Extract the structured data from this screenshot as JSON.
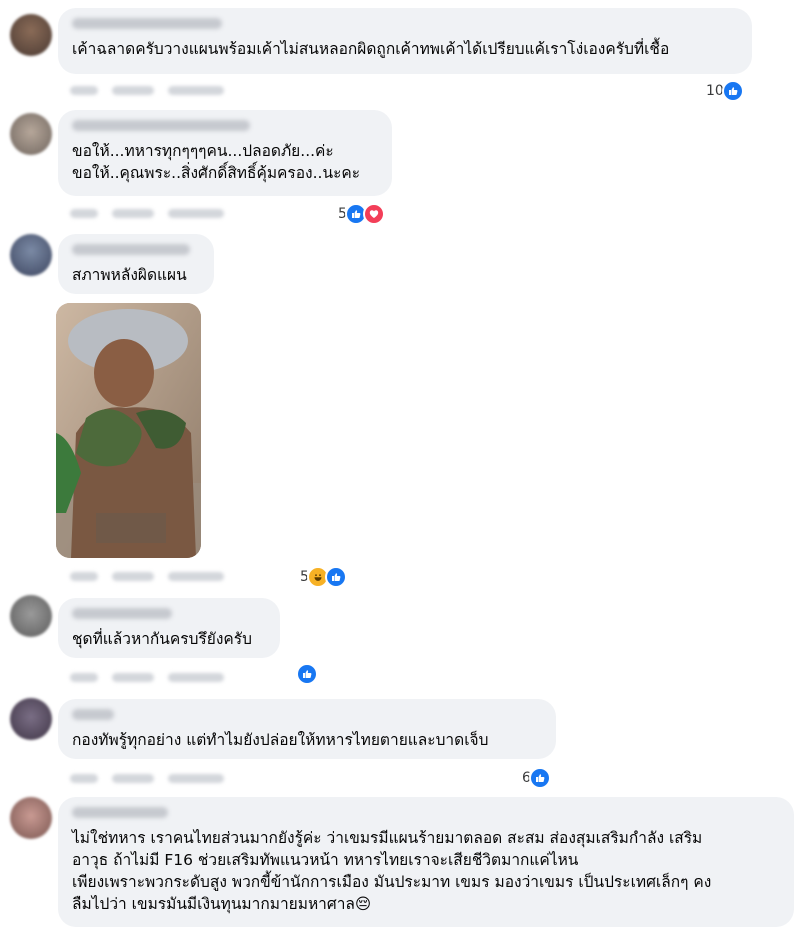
{
  "comments": [
    {
      "text": "เค้าฉลาดครับวางแผนพร้อมเค้าไม่สนหลอกผิดถูกเค้าทพเค้าได้เปรียบแค้เราโง่เองครับที่เชื้อ",
      "reaction_count": "10",
      "reactions": [
        "like"
      ]
    },
    {
      "text": "ขอให้...ทหารทุกๆๆๆคน...ปลอดภัย...ค่ะ\nขอให้..คุณพระ..สิ่งศักดิ์สิทธิ์คุ้มครอง..นะคะ",
      "reaction_count": "5",
      "reactions": [
        "like",
        "love"
      ]
    },
    {
      "text": "สภาพหลังผิดแผน",
      "reaction_count": "5",
      "reactions": [
        "haha",
        "like"
      ],
      "has_photo": true
    },
    {
      "text": "ชุดที่แล้วหากันครบรึยังครับ",
      "reaction_count": "",
      "reactions": [
        "like"
      ]
    },
    {
      "text": "กองทัพรู้ทุกอย่าง แต่ทำไมยังปล่อยให้ทหารไทยตายและบาดเจ็บ",
      "reaction_count": "6",
      "reactions": [
        "like"
      ]
    },
    {
      "text": "ไม่ใช่ทหาร เราคนไทยส่วนมากยังรู้ค่ะ ว่าเขมรมีแผนร้ายมาตลอด สะสม ส่องสุมเสริมกำลัง เสริม\nอาวุธ ถ้าไม่มี F16 ช่วยเสริมทัพแนวหน้า ทหารไทยเราจะเสียชีวิตมากแค่ไหน\nเพียงเพราะพวกระดับสูง พวกขี้ข้านักการเมือง มันประมาท เขมร มองว่าเขมร เป็นประเทศเล็กๆ คง\nลืมไปว่า เขมรมันมีเงินทุนมากมายมหาศาล😔",
      "reaction_count": "",
      "reactions": []
    }
  ],
  "colors": {
    "bubble": "#f0f2f5",
    "like": "#1877f2",
    "love": "#f33e58",
    "haha": "#f7b125"
  }
}
